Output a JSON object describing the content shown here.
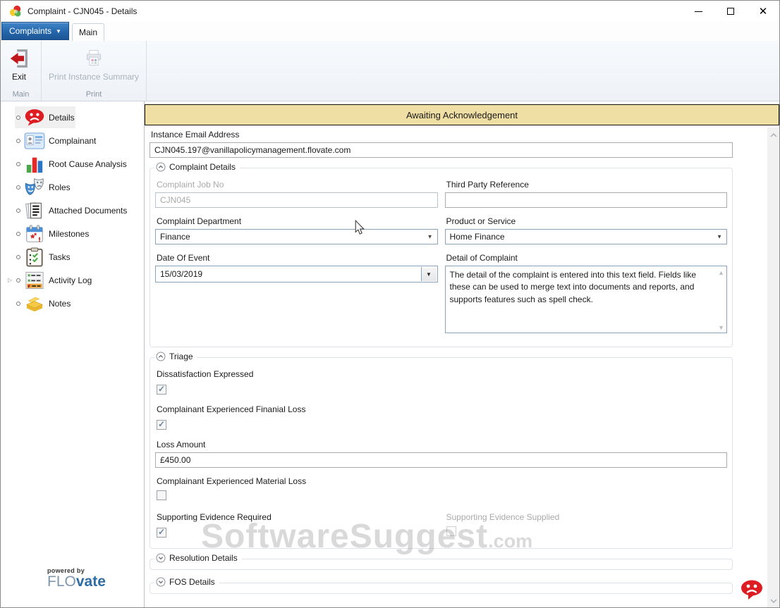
{
  "window": {
    "title": "Complaint - CJN045 - Details"
  },
  "tabs": {
    "complaints": "Complaints",
    "main": "Main"
  },
  "ribbon": {
    "exit_label": "Exit",
    "print_label": "Print Instance Summary",
    "group_main": "Main",
    "group_print": "Print"
  },
  "sidebar": {
    "items": [
      {
        "label": "Details",
        "icon": "sad-face-bubble",
        "selected": true
      },
      {
        "label": "Complainant",
        "icon": "id-card"
      },
      {
        "label": "Root Cause Analysis",
        "icon": "bar-chart"
      },
      {
        "label": "Roles",
        "icon": "theatre-masks"
      },
      {
        "label": "Attached Documents",
        "icon": "documents"
      },
      {
        "label": "Milestones",
        "icon": "calendar"
      },
      {
        "label": "Tasks",
        "icon": "clipboard-checks"
      },
      {
        "label": "Activity Log",
        "icon": "log-list",
        "expandable": true
      },
      {
        "label": "Notes",
        "icon": "sticky-notes"
      }
    ],
    "powered_by": "powered by",
    "logo_flo": "FLO",
    "logo_vate": "vate"
  },
  "content": {
    "status_banner": "Awaiting Acknowledgement",
    "email": {
      "label": "Instance Email Address",
      "value": "CJN045.197@vanillapolicymanagement.flovate.com"
    },
    "sections": {
      "complaint_details": {
        "title": "Complaint Details",
        "job_no": {
          "label": "Complaint Job No",
          "value": "CJN045",
          "disabled": true
        },
        "third_party": {
          "label": "Third Party Reference",
          "value": ""
        },
        "department": {
          "label": "Complaint Department",
          "value": "Finance"
        },
        "product": {
          "label": "Product or Service",
          "value": "Home Finance"
        },
        "date_of_event": {
          "label": "Date Of Event",
          "value": "15/03/2019"
        },
        "detail": {
          "label": "Detail of Complaint",
          "value": "The detail of the complaint is entered into this text field. Fields like these can be used to merge text into documents and reports, and supports features such as spell check."
        }
      },
      "triage": {
        "title": "Triage",
        "dissatisfaction": {
          "label": "Dissatisfaction Expressed",
          "checked": true
        },
        "financial_loss": {
          "label": "Complainant Experienced Finanial Loss",
          "checked": true
        },
        "loss_amount": {
          "label": "Loss Amount",
          "value": "£450.00"
        },
        "material_loss": {
          "label": "Complainant Experienced Material Loss",
          "checked": false
        },
        "evidence_required": {
          "label": "Supporting Evidence Required",
          "checked": true
        },
        "evidence_supplied": {
          "label": "Supporting Evidence Supplied",
          "checked": false,
          "disabled": true
        }
      },
      "resolution": {
        "title": "Resolution Details",
        "collapsed": true
      },
      "fos": {
        "title": "FOS Details",
        "collapsed": true
      }
    },
    "watermark": {
      "text": "SoftwareSuggest",
      "suffix": ".com"
    }
  },
  "colors": {
    "banner_bg": "#f0dfa4",
    "complaints_button_blue": "#2363a8",
    "brand_red": "#dd1d21",
    "logo_blue": "#2e6da4",
    "dropdown_border": "#8aa3bd"
  }
}
